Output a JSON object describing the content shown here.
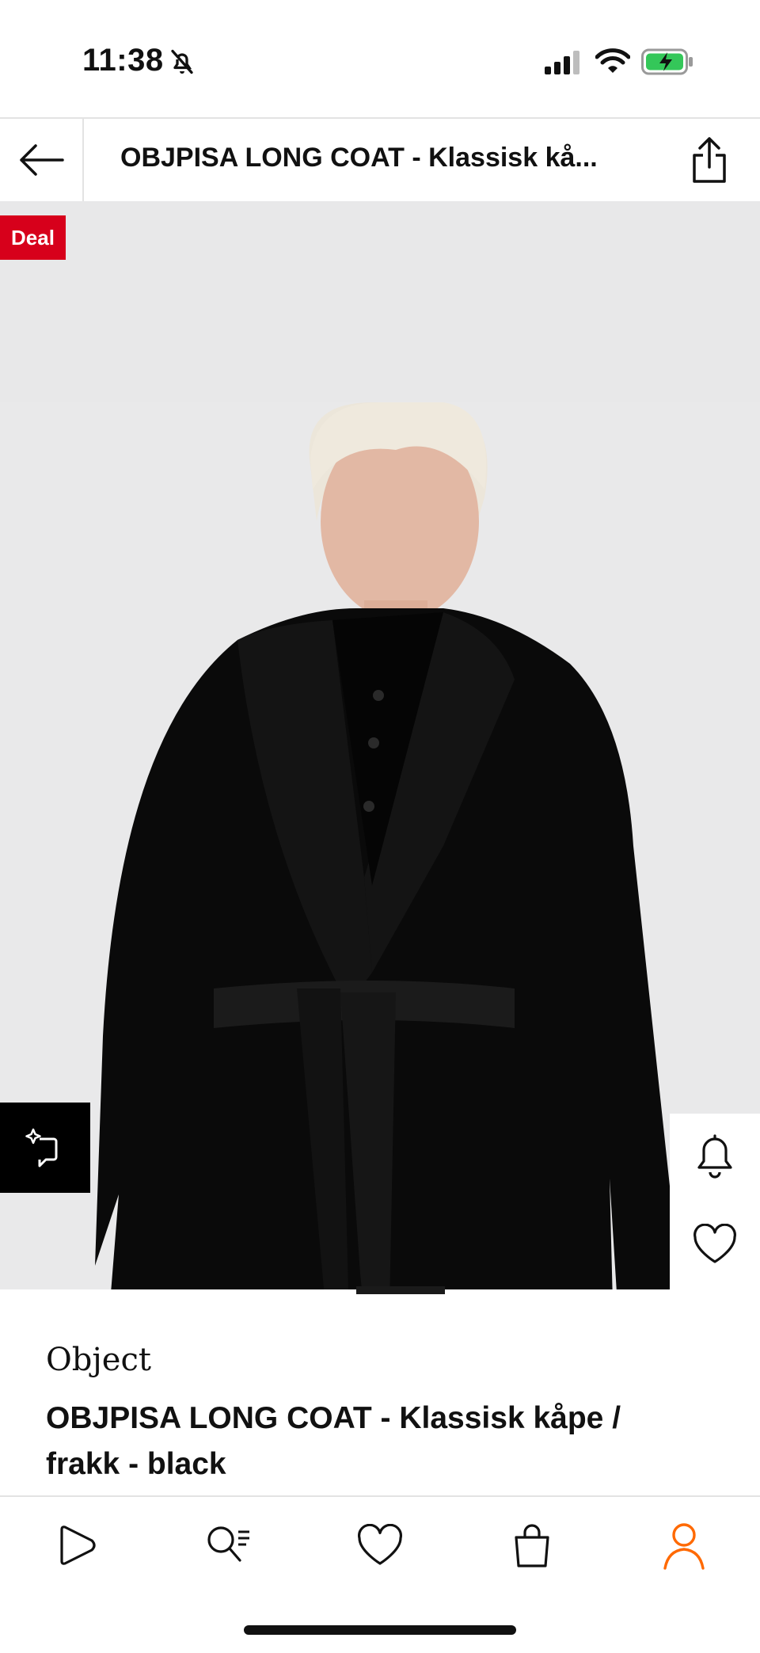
{
  "status_bar": {
    "time": "11:38",
    "icons": [
      "bell-slash-icon",
      "cellular-signal-icon",
      "wifi-icon",
      "battery-charging-icon"
    ],
    "battery_color": "#34c759"
  },
  "header": {
    "title": "OBJPISA LONG COAT - Klassisk kå...",
    "back_icon": "arrow-left-icon",
    "share_icon": "share-icon"
  },
  "product_image": {
    "badge": "Deal",
    "badge_color": "#d7001b",
    "similar_icon": "find-similar-icon",
    "side_actions": [
      "bell-icon",
      "heart-icon"
    ]
  },
  "product": {
    "brand": "Object",
    "name": "OBJPISA LONG COAT - Klassisk kåpe / frakk - black"
  },
  "tab_bar": {
    "tabs": [
      {
        "icon": "play-icon",
        "active": false
      },
      {
        "icon": "search-list-icon",
        "active": false
      },
      {
        "icon": "heart-icon",
        "active": false
      },
      {
        "icon": "shopping-bag-icon",
        "active": false
      },
      {
        "icon": "person-icon",
        "active": true
      }
    ],
    "accent": "#ff6900"
  }
}
